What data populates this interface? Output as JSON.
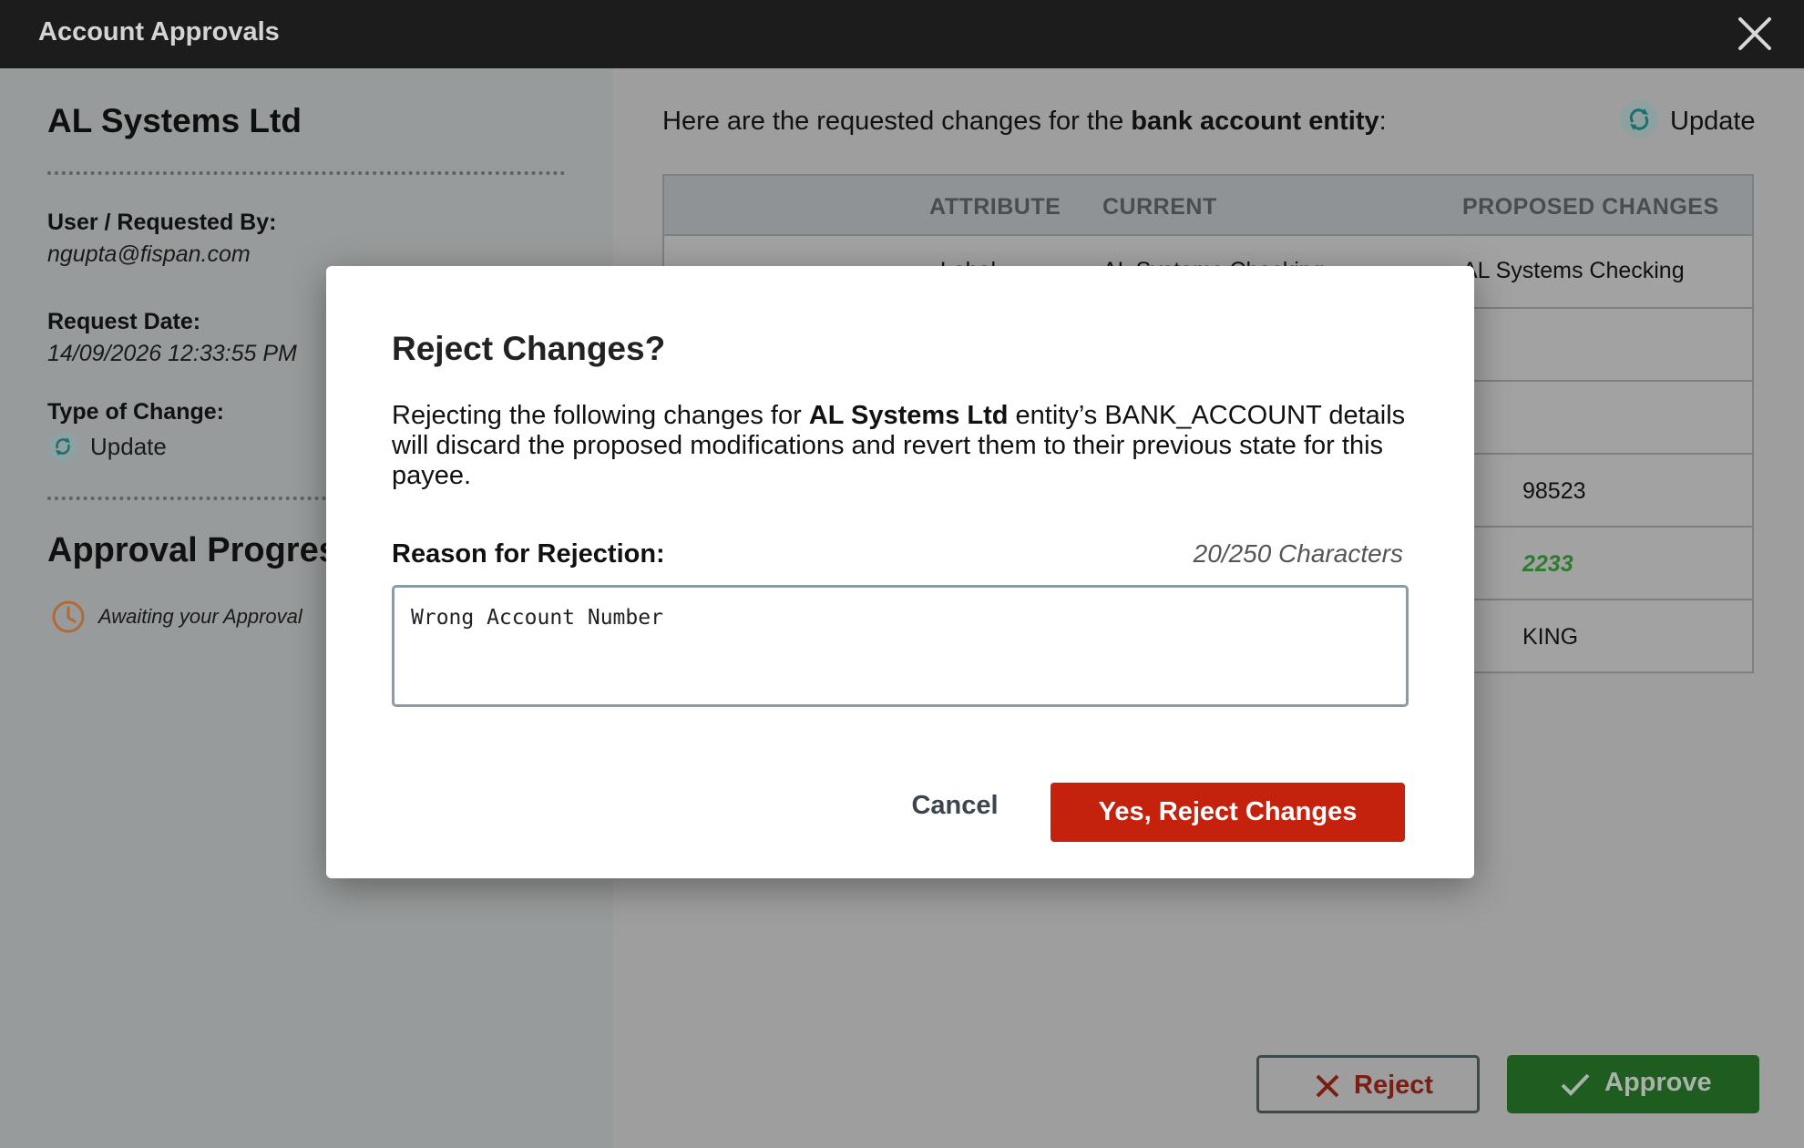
{
  "window": {
    "title": "Account Approvals"
  },
  "left": {
    "company": "AL Systems Ltd",
    "requested_by_label": "User / Requested By:",
    "requested_by": "ngupta@fispan.com",
    "request_date_label": "Request Date:",
    "request_date": "14/09/2026 12:33:55 PM",
    "type_label": "Type of Change:",
    "type_value": "Update",
    "progress_title": "Approval Progress",
    "progress_status": "Awaiting your Approval"
  },
  "right": {
    "intro_prefix": "Here are the requested changes for the ",
    "intro_bold": "bank account entity",
    "intro_suffix": ":",
    "update_label": "Update",
    "columns": [
      "ATTRIBUTE",
      "CURRENT",
      "PROPOSED CHANGES"
    ],
    "visible_fragments": {
      "row1_attribute": "Label",
      "row1_current": "AL Systems Checking",
      "row1_proposed": "AL Systems Checking",
      "row4_proposed": "98523",
      "row5_proposed": "2233",
      "row6_proposed": "KING"
    },
    "reject_label": "Reject",
    "approve_label": "Approve"
  },
  "modal": {
    "title": "Reject Changes?",
    "body_prefix": "Rejecting the following changes for ",
    "body_bold": "AL Systems Ltd",
    "body_suffix": " entity’s BANK_ACCOUNT details will discard the proposed modifications and revert them to their previous state for this payee.",
    "reason_label": "Reason for Rejection:",
    "char_count": "20/250 Characters",
    "reason_value": "Wrong Account Number",
    "cancel_label": "Cancel",
    "confirm_label": "Yes, Reject Changes"
  },
  "colors": {
    "titlebar": "#1c1c1c",
    "reject_red": "#c5220e",
    "approve_green": "#1f5c1f",
    "overlay": "#9a9c9c"
  }
}
